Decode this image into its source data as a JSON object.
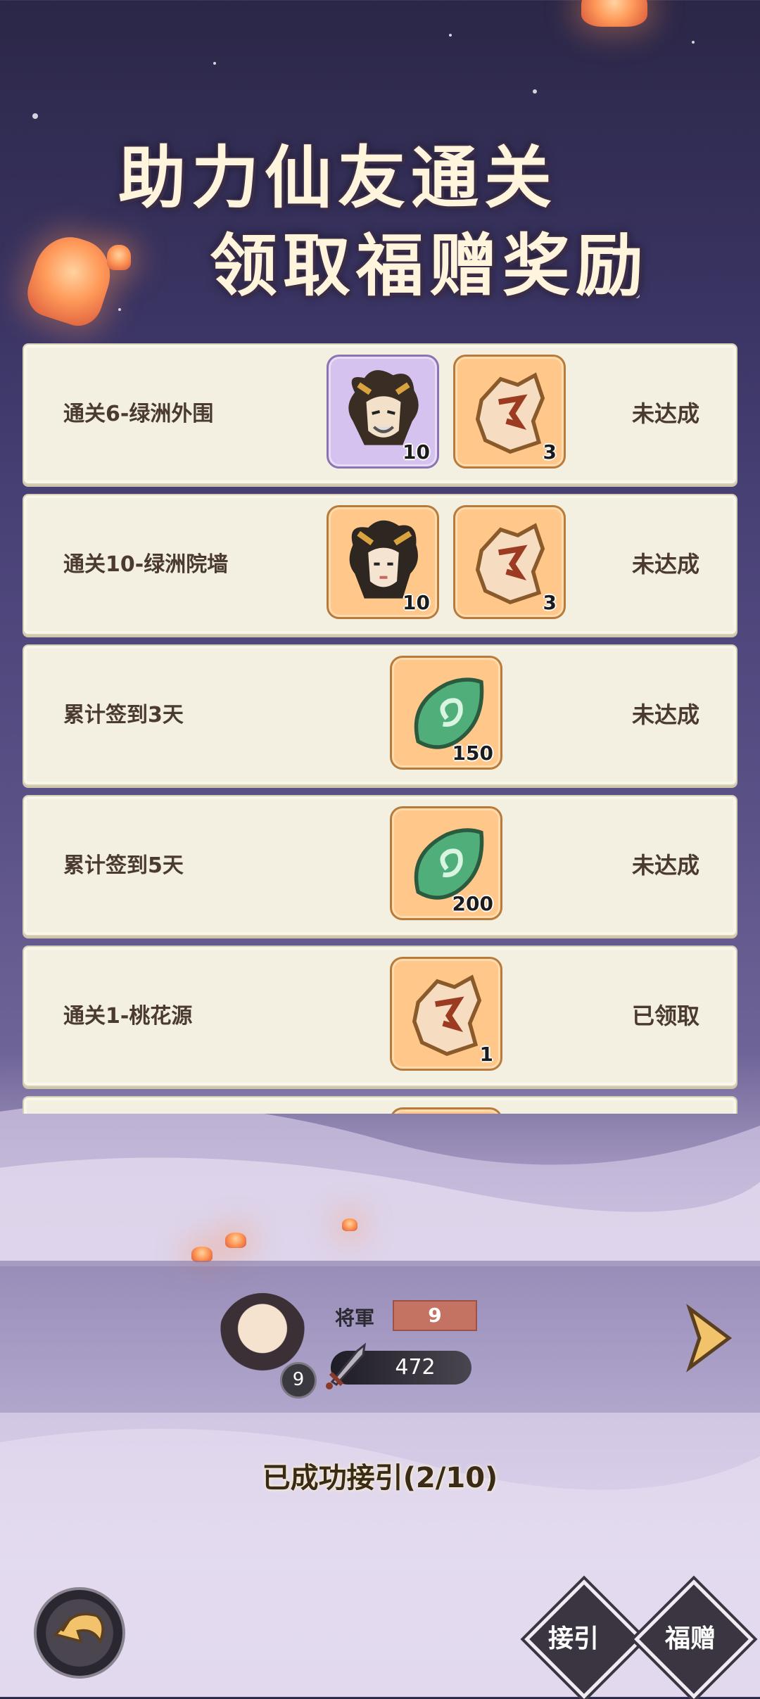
{
  "header": {
    "title_line1": "助力仙友通关",
    "title_line2": "领取福赠奖励"
  },
  "tasks": [
    {
      "label": "通关6-绿洲外围",
      "status": "未达成",
      "rewards": [
        {
          "icon": "general-portrait-icon",
          "count": "10",
          "frame": "purple"
        },
        {
          "icon": "token-plate-icon",
          "count": "3",
          "frame": "orange"
        }
      ]
    },
    {
      "label": "通关10-绿洲院墙",
      "status": "未达成",
      "rewards": [
        {
          "icon": "general-portrait-icon",
          "count": "10",
          "frame": "orange"
        },
        {
          "icon": "token-plate-icon",
          "count": "3",
          "frame": "orange"
        }
      ]
    },
    {
      "label": "累计签到3天",
      "status": "未达成",
      "rewards": [
        {
          "icon": "jade-leaf-icon",
          "count": "150",
          "frame": "orange"
        }
      ]
    },
    {
      "label": "累计签到5天",
      "status": "未达成",
      "rewards": [
        {
          "icon": "jade-leaf-icon",
          "count": "200",
          "frame": "orange"
        }
      ]
    },
    {
      "label": "通关1-桃花源",
      "status": "已领取",
      "rewards": [
        {
          "icon": "token-plate-icon",
          "count": "1",
          "frame": "orange"
        }
      ]
    }
  ],
  "player": {
    "avatar_level": "9",
    "rank_label": "将軍",
    "rank_value": "9",
    "power": "472"
  },
  "invite_status": "已成功接引(2/10)",
  "buttons": {
    "invite": "接引",
    "reward": "福赠"
  },
  "colors": {
    "card_bg": "#f3efe1",
    "reward_orange": "#ffc78a",
    "reward_purple": "#d6c2ee",
    "text_brown": "#4a3a30"
  }
}
